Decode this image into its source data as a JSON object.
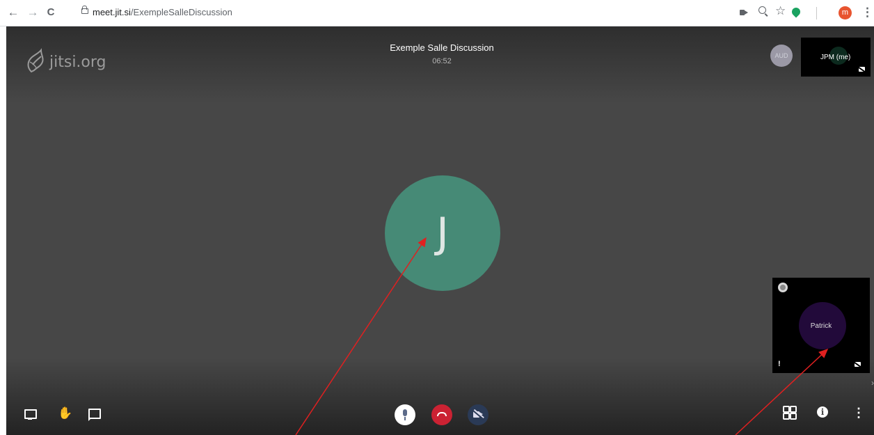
{
  "browser": {
    "url_host": "meet.jit.si",
    "url_path": "/ExempleSalleDiscussion",
    "profile_initial": "m",
    "icons": [
      "back-icon",
      "forward-icon",
      "reload-icon",
      "lock-icon",
      "camera-icon",
      "zoom-icon",
      "star-icon",
      "extension-icon",
      "profile-avatar",
      "menu-icon"
    ]
  },
  "meeting": {
    "logo_text": "jitsi.org",
    "title": "Exemple Salle Discussion",
    "timer": "06:52",
    "main_avatar_initial": "J",
    "main_avatar_color": "#468a76"
  },
  "filmstrip": {
    "remote_audio_avatar": "AUD",
    "self_label": "JPM (me)",
    "participant_label": "Patrick",
    "participant_warning": "!"
  },
  "toolbar": {
    "left": [
      "screenshare-icon",
      "raise-hand-icon",
      "chat-icon"
    ],
    "center": [
      "microphone-icon",
      "hangup-icon",
      "camera-off-icon"
    ],
    "right": [
      "tile-view-icon",
      "info-icon",
      "more-icon"
    ],
    "hangup_color": "#cb2233"
  },
  "glyphs": {
    "back": "←",
    "forward": "→",
    "reload": "C",
    "star": "☆",
    "kebab": "⋮",
    "hand": "✋",
    "info": "i",
    "more": "⋮",
    "chevron": "›"
  }
}
